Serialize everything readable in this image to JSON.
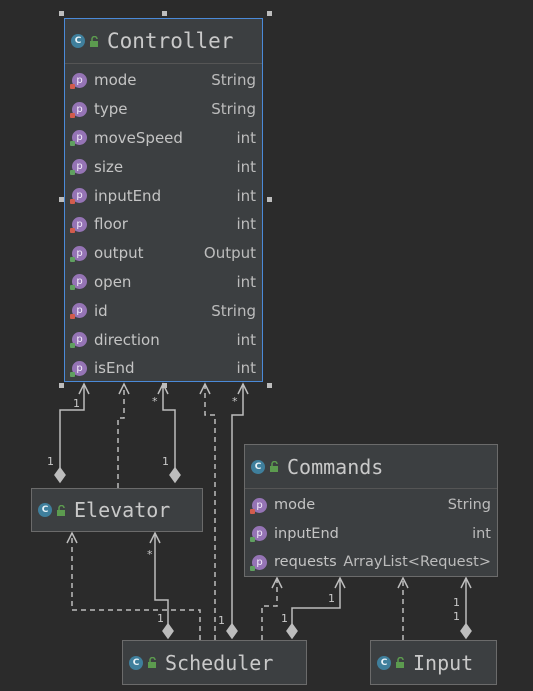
{
  "nodes": {
    "controller": {
      "name": "Controller",
      "fields": [
        {
          "name": "mode",
          "type": "String"
        },
        {
          "name": "type",
          "type": "String"
        },
        {
          "name": "moveSpeed",
          "type": "int"
        },
        {
          "name": "size",
          "type": "int"
        },
        {
          "name": "inputEnd",
          "type": "int"
        },
        {
          "name": "floor",
          "type": "int"
        },
        {
          "name": "output",
          "type": "Output"
        },
        {
          "name": "open",
          "type": "int"
        },
        {
          "name": "id",
          "type": "String"
        },
        {
          "name": "direction",
          "type": "int"
        },
        {
          "name": "isEnd",
          "type": "int"
        }
      ]
    },
    "commands": {
      "name": "Commands",
      "fields": [
        {
          "name": "mode",
          "type": "String"
        },
        {
          "name": "inputEnd",
          "type": "int"
        },
        {
          "name": "requests",
          "type": "ArrayList<Request>"
        }
      ]
    },
    "elevator": {
      "name": "Elevator"
    },
    "scheduler": {
      "name": "Scheduler"
    },
    "input": {
      "name": "Input"
    }
  },
  "icons": {
    "class_badge": "C",
    "field_badge": "p"
  },
  "multiplicities": {
    "elevator_controller_top": "1",
    "elevator_controller_bottom": "1",
    "elevator_controller_star": "*",
    "elevator_controller_one": "1",
    "scheduler_controller_star": "*",
    "scheduler_controller_one": "1",
    "scheduler_elevator_star": "*",
    "scheduler_elevator_one": "1",
    "scheduler_commands_top": "1",
    "scheduler_commands_bottom": "1",
    "input_commands_top": "1",
    "input_commands_bottom": "1"
  },
  "colors": {
    "background": "#2b2b2b",
    "node_fill": "#3c3f41",
    "selection_border": "#4b8ad8",
    "class_icon": "#3f7f9c",
    "field_icon": "#9574b5"
  }
}
